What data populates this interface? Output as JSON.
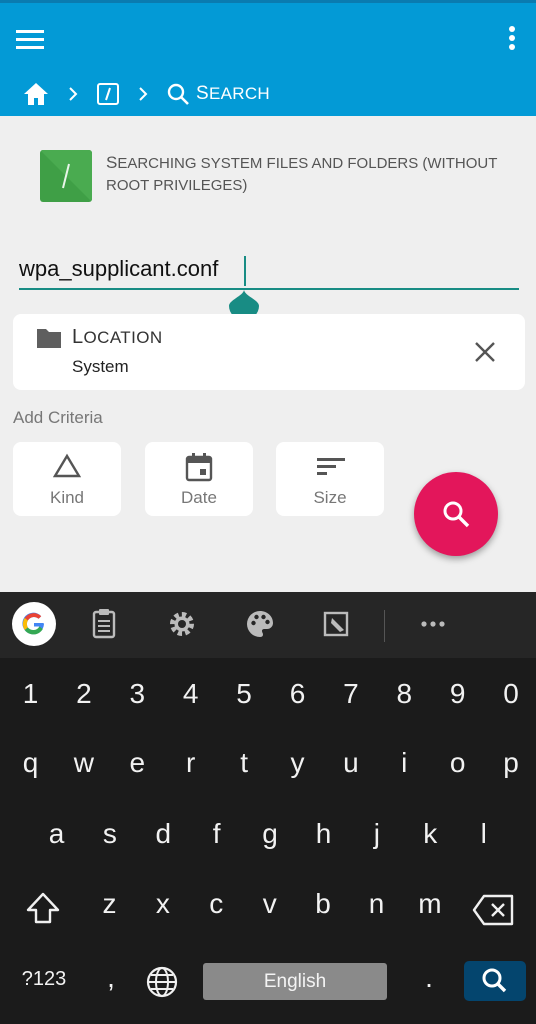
{
  "header": {
    "breadcrumb": {
      "search_first": "S",
      "search_rest": "EARCH"
    }
  },
  "info": {
    "first_letter": "S",
    "text": "EARCHING SYSTEM FILES AND FOLDERS (WITHOUT ROOT PRIVILEGES)",
    "icon_glyph": "/"
  },
  "search": {
    "value": "wpa_supplicant.conf"
  },
  "location": {
    "title_first": "L",
    "title_rest": "OCATION",
    "value": "System"
  },
  "criteria": {
    "header": "Add Criteria",
    "items": [
      {
        "label": "Kind"
      },
      {
        "label": "Date"
      },
      {
        "label": "Size"
      }
    ]
  },
  "keyboard": {
    "numbers": [
      "1",
      "2",
      "3",
      "4",
      "5",
      "6",
      "7",
      "8",
      "9",
      "0"
    ],
    "row1": [
      "q",
      "w",
      "e",
      "r",
      "t",
      "y",
      "u",
      "i",
      "o",
      "p"
    ],
    "row2": [
      "a",
      "s",
      "d",
      "f",
      "g",
      "h",
      "j",
      "k",
      "l"
    ],
    "row3": [
      "z",
      "x",
      "c",
      "v",
      "b",
      "n",
      "m"
    ],
    "symbols_label": "?123",
    "comma": ",",
    "space_label": "English",
    "period": "."
  },
  "colors": {
    "appbar": "#039ad6",
    "accent": "#188c84",
    "fab": "#e3165b",
    "root_icon": "#3f9f46",
    "keyboard_bg": "#1b1b1b",
    "enter_key": "#04456e"
  },
  "icons": {
    "appbar": [
      "menu-icon",
      "more-vert-icon",
      "home-icon",
      "root-folder-icon",
      "search-icon"
    ],
    "toolbar": [
      "google-logo-icon",
      "clipboard-icon",
      "settings-icon",
      "palette-icon",
      "edit-icon",
      "more-horiz-icon"
    ]
  }
}
